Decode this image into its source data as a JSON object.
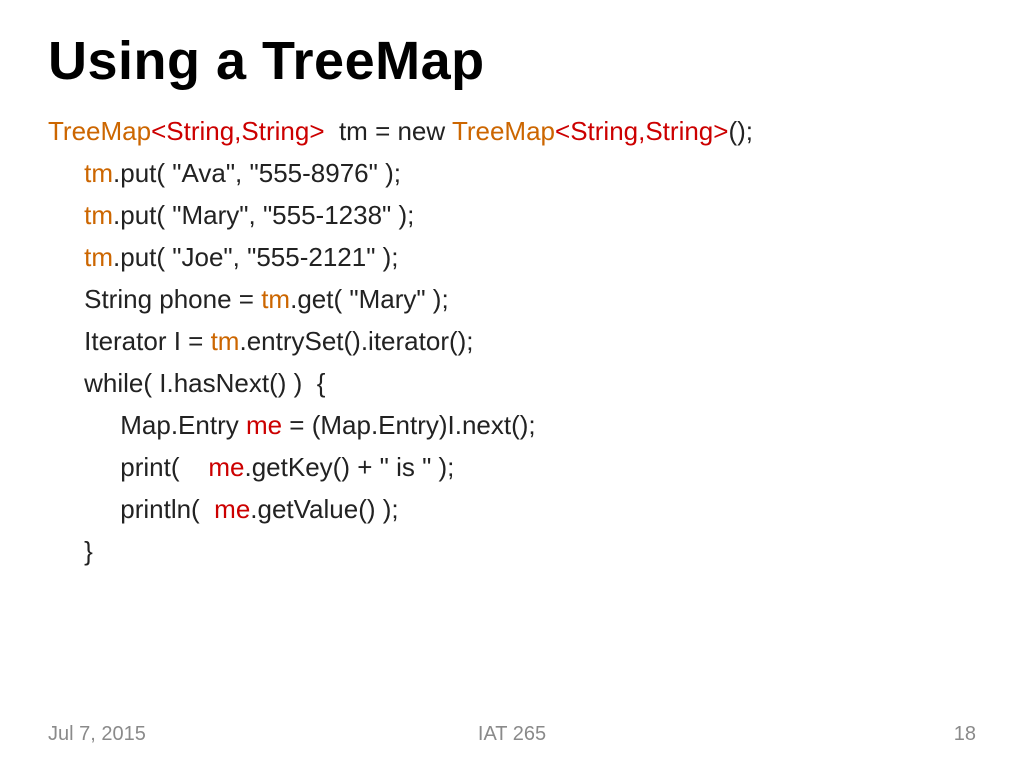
{
  "title": "Using a TreeMap",
  "code": {
    "l1": {
      "a": "TreeMap",
      "b": "<String,String>",
      "c": "  tm = new ",
      "d": "TreeMap",
      "e": "<String,String>",
      "f": "();"
    },
    "l2": {
      "a": "     ",
      "b": "tm",
      "c": ".put( \"Ava\", \"555-8976\" );"
    },
    "l3": {
      "a": "     ",
      "b": "tm",
      "c": ".put( \"Mary\", \"555-1238\" );"
    },
    "l4": {
      "a": "     ",
      "b": "tm",
      "c": ".put( \"Joe\", \"555-2121\" );"
    },
    "l5": {
      "a": "     String phone = ",
      "b": "tm",
      "c": ".get( \"Mary\" );"
    },
    "l6": {
      "a": "     Iterator I = ",
      "b": "tm",
      "c": ".entrySet().iterator();"
    },
    "l7": "     while( I.hasNext() )  {",
    "l8": {
      "a": "          Map.Entry ",
      "b": "me",
      "c": " = (Map.Entry)I.next();"
    },
    "l9": {
      "a": "          print(    ",
      "b": "me",
      "c": ".getKey() + \" is \" );"
    },
    "l10": {
      "a": "          println(  ",
      "b": "me",
      "c": ".getValue() );"
    },
    "l11": "     }"
  },
  "footer": {
    "date": "Jul 7, 2015",
    "course": "IAT 265",
    "page": "18"
  }
}
